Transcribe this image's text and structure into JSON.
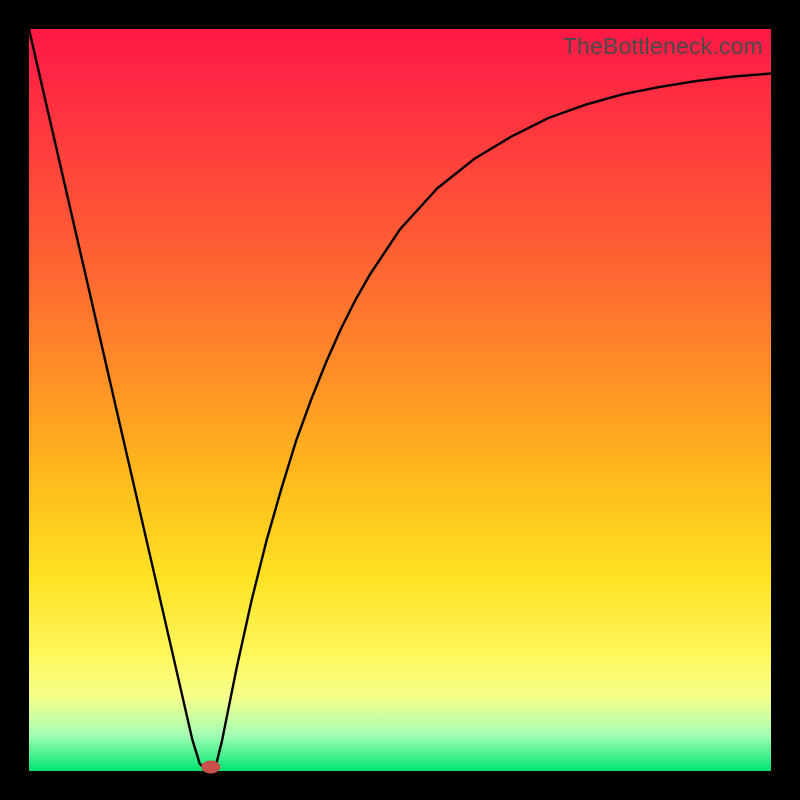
{
  "watermark": "TheBottleneck.com",
  "chart_data": {
    "type": "line",
    "title": "",
    "xlabel": "",
    "ylabel": "",
    "xlim": [
      0,
      100
    ],
    "ylim": [
      0,
      100
    ],
    "x": [
      0,
      2,
      4,
      6,
      8,
      10,
      12,
      14,
      16,
      18,
      20,
      22,
      23,
      24,
      25,
      26,
      28,
      30,
      32,
      34,
      36,
      38,
      40,
      42,
      44,
      46,
      48,
      50,
      55,
      60,
      65,
      70,
      75,
      80,
      85,
      90,
      95,
      100
    ],
    "values": [
      100,
      91.3,
      82.6,
      73.9,
      65.2,
      56.5,
      47.8,
      39.1,
      30.4,
      21.7,
      13.0,
      4.3,
      1.0,
      0.0,
      0.0,
      4.0,
      14.0,
      23.0,
      31.0,
      38.0,
      44.5,
      50.0,
      55.0,
      59.5,
      63.5,
      67.0,
      70.0,
      73.0,
      78.5,
      82.5,
      85.5,
      88.0,
      89.8,
      91.2,
      92.2,
      93.0,
      93.6,
      94.0
    ],
    "marker": {
      "x": 24.5,
      "y": 0
    },
    "grid": false,
    "legend": false
  }
}
